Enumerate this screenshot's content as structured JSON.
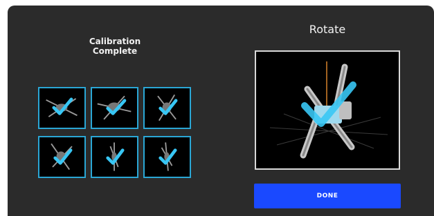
{
  "calibration": {
    "title": "Calibration Complete",
    "orientations": [
      {
        "name": "drone-orientation-1",
        "complete": true,
        "icon": "check-icon"
      },
      {
        "name": "drone-orientation-2",
        "complete": true,
        "icon": "check-icon"
      },
      {
        "name": "drone-orientation-3",
        "complete": true,
        "icon": "check-icon"
      },
      {
        "name": "drone-orientation-4",
        "complete": true,
        "icon": "check-icon"
      },
      {
        "name": "drone-orientation-5",
        "complete": true,
        "icon": "check-icon"
      },
      {
        "name": "drone-orientation-6",
        "complete": true,
        "icon": "check-icon"
      }
    ]
  },
  "rotate": {
    "title": "Rotate"
  },
  "actions": {
    "done_label": "DONE"
  },
  "colors": {
    "panel_bg": "#2b2b2b",
    "cell_border": "#2aa7d6",
    "check": "#38c6f4",
    "button": "#1a49ff"
  }
}
